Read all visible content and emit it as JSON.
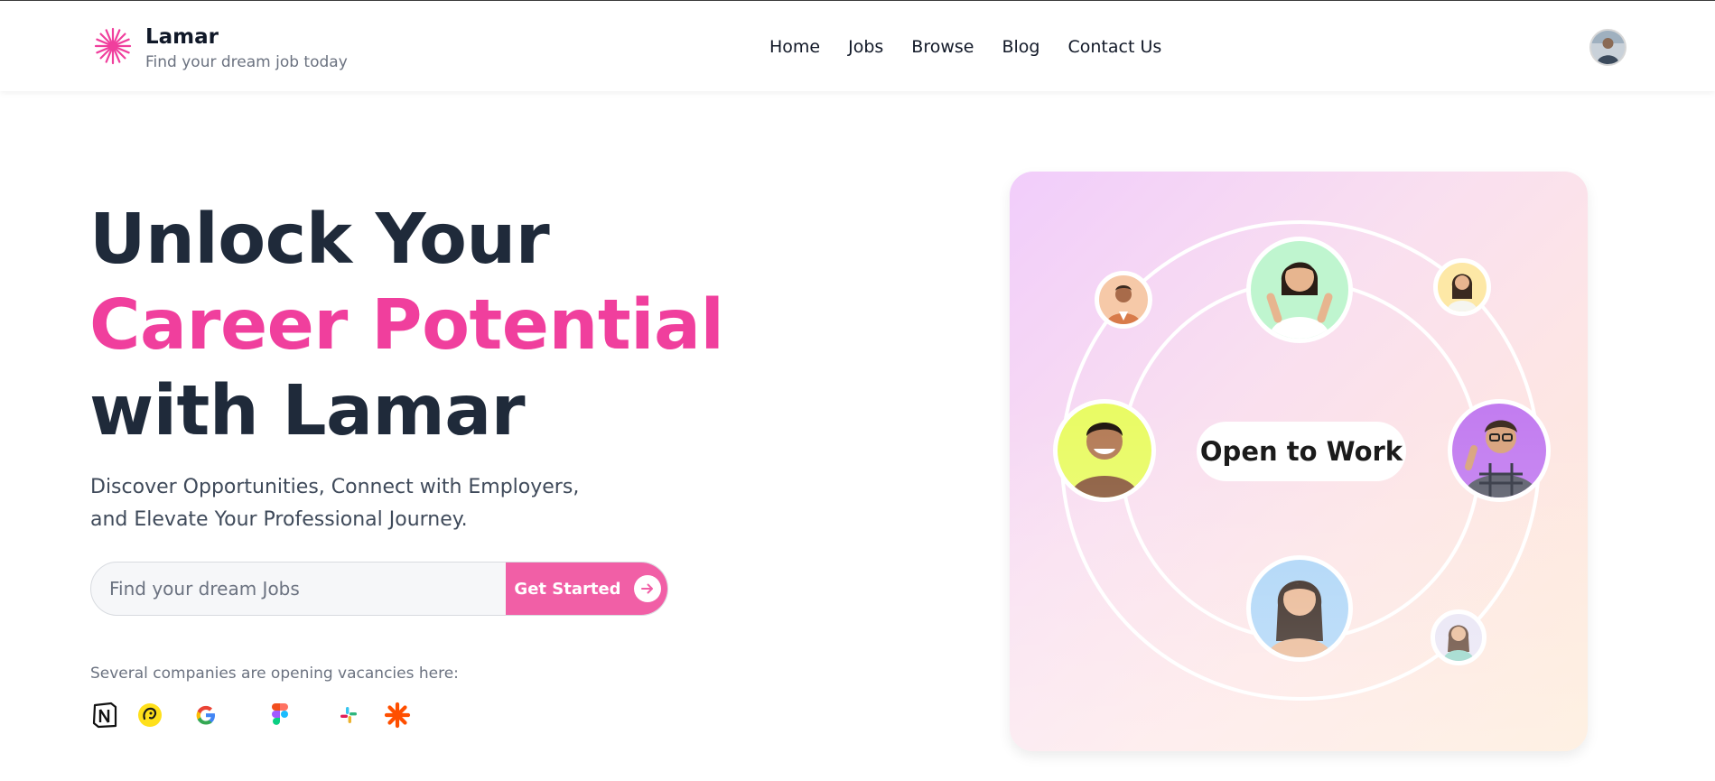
{
  "brand": {
    "name": "Lamar",
    "tagline": "Find your dream job today",
    "accent_color": "#f03f9d"
  },
  "nav": {
    "items": [
      {
        "label": "Home"
      },
      {
        "label": "Jobs"
      },
      {
        "label": "Browse"
      },
      {
        "label": "Blog"
      },
      {
        "label": "Contact Us"
      }
    ]
  },
  "hero": {
    "title_line1": "Unlock Your",
    "title_line2": "Career Potential",
    "title_line3": "with Lamar",
    "subtitle": "Discover Opportunities, Connect with Employers, and Elevate Your Professional Journey."
  },
  "search": {
    "placeholder": "Find your dream Jobs",
    "value": "",
    "button_label": "Get Started",
    "button_color": "#f15fa6"
  },
  "companies": {
    "label": "Several companies are opening vacancies here:",
    "logos": [
      "notion-icon",
      "mailchimp-icon",
      "google-icon",
      "figma-icon",
      "slack-icon",
      "zapier-icon"
    ]
  },
  "card": {
    "badge": "Open to Work",
    "people_backgrounds": [
      "#f6c9a8",
      "#bff5cf",
      "#fde8a6",
      "#e9fb64",
      "#c27cf0",
      "#a9d3f7",
      "#e7e3f4"
    ]
  }
}
